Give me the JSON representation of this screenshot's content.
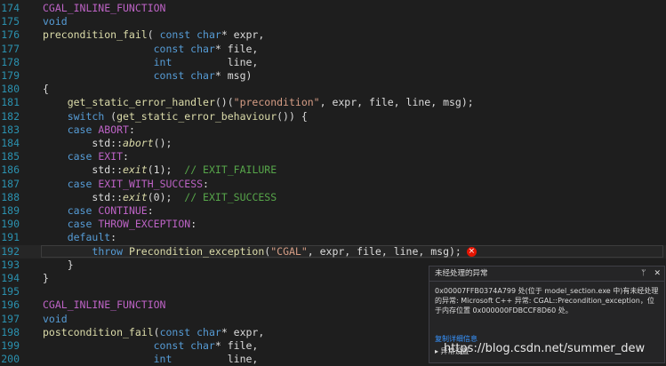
{
  "editor": {
    "lines": [
      {
        "n": "174",
        "tokens": [
          {
            "t": "CGAL_INLINE_FUNCTION",
            "c": "mac"
          }
        ]
      },
      {
        "n": "175",
        "tokens": [
          {
            "t": "void",
            "c": "kw"
          }
        ]
      },
      {
        "n": "176",
        "tokens": [
          {
            "t": "precondition_fail",
            "c": "fn"
          },
          {
            "t": "( ",
            "c": "pl"
          },
          {
            "t": "const char",
            "c": "kw"
          },
          {
            "t": "* expr,",
            "c": "pl"
          }
        ]
      },
      {
        "n": "177",
        "tokens": [
          {
            "t": "                  ",
            "c": "pl"
          },
          {
            "t": "const char",
            "c": "kw"
          },
          {
            "t": "* file,",
            "c": "pl"
          }
        ]
      },
      {
        "n": "178",
        "tokens": [
          {
            "t": "                  ",
            "c": "pl"
          },
          {
            "t": "int",
            "c": "kw"
          },
          {
            "t": "         line,",
            "c": "pl"
          }
        ]
      },
      {
        "n": "179",
        "tokens": [
          {
            "t": "                  ",
            "c": "pl"
          },
          {
            "t": "const char",
            "c": "kw"
          },
          {
            "t": "* msg)",
            "c": "pl"
          }
        ]
      },
      {
        "n": "180",
        "tokens": [
          {
            "t": "{",
            "c": "pl"
          }
        ]
      },
      {
        "n": "181",
        "tokens": [
          {
            "t": "    ",
            "c": "pl"
          },
          {
            "t": "get_static_error_handler",
            "c": "fn"
          },
          {
            "t": "()(",
            "c": "pl"
          },
          {
            "t": "\"precondition\"",
            "c": "str"
          },
          {
            "t": ", expr, file, line, msg);",
            "c": "pl"
          }
        ]
      },
      {
        "n": "182",
        "tokens": [
          {
            "t": "    ",
            "c": "pl"
          },
          {
            "t": "switch",
            "c": "kw"
          },
          {
            "t": " (",
            "c": "pl"
          },
          {
            "t": "get_static_error_behaviour",
            "c": "fn"
          },
          {
            "t": "()) {",
            "c": "pl"
          }
        ]
      },
      {
        "n": "183",
        "tokens": [
          {
            "t": "    ",
            "c": "pl"
          },
          {
            "t": "case",
            "c": "kw"
          },
          {
            "t": " ",
            "c": "pl"
          },
          {
            "t": "ABORT",
            "c": "mac"
          },
          {
            "t": ":",
            "c": "pl"
          }
        ]
      },
      {
        "n": "184",
        "tokens": [
          {
            "t": "        std",
            "c": "pl"
          },
          {
            "t": "::",
            "c": "pl"
          },
          {
            "t": "abort",
            "c": "it"
          },
          {
            "t": "();",
            "c": "pl"
          }
        ]
      },
      {
        "n": "185",
        "tokens": [
          {
            "t": "    ",
            "c": "pl"
          },
          {
            "t": "case",
            "c": "kw"
          },
          {
            "t": " ",
            "c": "pl"
          },
          {
            "t": "EXIT",
            "c": "mac"
          },
          {
            "t": ":",
            "c": "pl"
          }
        ]
      },
      {
        "n": "186",
        "tokens": [
          {
            "t": "        std",
            "c": "pl"
          },
          {
            "t": "::",
            "c": "pl"
          },
          {
            "t": "exit",
            "c": "it"
          },
          {
            "t": "(1);  ",
            "c": "pl"
          },
          {
            "t": "// EXIT_FAILURE",
            "c": "cm"
          }
        ]
      },
      {
        "n": "187",
        "tokens": [
          {
            "t": "    ",
            "c": "pl"
          },
          {
            "t": "case",
            "c": "kw"
          },
          {
            "t": " ",
            "c": "pl"
          },
          {
            "t": "EXIT_WITH_SUCCESS",
            "c": "mac"
          },
          {
            "t": ":",
            "c": "pl"
          }
        ]
      },
      {
        "n": "188",
        "tokens": [
          {
            "t": "        std",
            "c": "pl"
          },
          {
            "t": "::",
            "c": "pl"
          },
          {
            "t": "exit",
            "c": "it"
          },
          {
            "t": "(0);  ",
            "c": "pl"
          },
          {
            "t": "// EXIT_SUCCESS",
            "c": "cm"
          }
        ]
      },
      {
        "n": "189",
        "tokens": [
          {
            "t": "    ",
            "c": "pl"
          },
          {
            "t": "case",
            "c": "kw"
          },
          {
            "t": " ",
            "c": "pl"
          },
          {
            "t": "CONTINUE",
            "c": "mac"
          },
          {
            "t": ":",
            "c": "pl"
          }
        ]
      },
      {
        "n": "190",
        "tokens": [
          {
            "t": "    ",
            "c": "pl"
          },
          {
            "t": "case",
            "c": "kw"
          },
          {
            "t": " ",
            "c": "pl"
          },
          {
            "t": "THROW_EXCEPTION",
            "c": "mac"
          },
          {
            "t": ":",
            "c": "pl"
          }
        ]
      },
      {
        "n": "191",
        "tokens": [
          {
            "t": "    ",
            "c": "pl"
          },
          {
            "t": "default",
            "c": "kw"
          },
          {
            "t": ":",
            "c": "pl"
          }
        ]
      },
      {
        "n": "192",
        "hl": true,
        "err": true,
        "tokens": [
          {
            "t": "        ",
            "c": "pl"
          },
          {
            "t": "throw",
            "c": "kw"
          },
          {
            "t": " ",
            "c": "pl"
          },
          {
            "t": "Precondition_exception",
            "c": "fn"
          },
          {
            "t": "(",
            "c": "pl"
          },
          {
            "t": "\"CGAL\"",
            "c": "str"
          },
          {
            "t": ", expr, file, line, msg);",
            "c": "pl"
          }
        ]
      },
      {
        "n": "193",
        "tokens": [
          {
            "t": "    }",
            "c": "pl"
          }
        ]
      },
      {
        "n": "194",
        "tokens": [
          {
            "t": "}",
            "c": "pl"
          }
        ]
      },
      {
        "n": "195",
        "tokens": []
      },
      {
        "n": "196",
        "tokens": [
          {
            "t": "CGAL_INLINE_FUNCTION",
            "c": "mac"
          }
        ]
      },
      {
        "n": "197",
        "tokens": [
          {
            "t": "void",
            "c": "kw"
          }
        ]
      },
      {
        "n": "198",
        "tokens": [
          {
            "t": "postcondition_fail",
            "c": "fn"
          },
          {
            "t": "(",
            "c": "pl"
          },
          {
            "t": "const char",
            "c": "kw"
          },
          {
            "t": "* expr,",
            "c": "pl"
          }
        ]
      },
      {
        "n": "199",
        "tokens": [
          {
            "t": "                  ",
            "c": "pl"
          },
          {
            "t": "const char",
            "c": "kw"
          },
          {
            "t": "* file,",
            "c": "pl"
          }
        ]
      },
      {
        "n": "200",
        "tokens": [
          {
            "t": "                  ",
            "c": "pl"
          },
          {
            "t": "int",
            "c": "kw"
          },
          {
            "t": "         line,",
            "c": "pl"
          }
        ]
      }
    ]
  },
  "popup": {
    "title": "未经处理的异常",
    "pin": "ᛘ",
    "close": "✕",
    "message": "0x00007FFB0374A799 处(位于 model_section.exe 中)有未经处理的异常: Microsoft C++ 异常: CGAL::Precondition_exception，位于内存位置 0x000000FDBCCF8D60 处。",
    "copy_link": "复制详细信息",
    "expand": "▸ 异常设置"
  },
  "watermark": "https://blog.csdn.net/summer_dew",
  "colors": {
    "error_icon": "#e51400",
    "link": "#3794ff"
  }
}
